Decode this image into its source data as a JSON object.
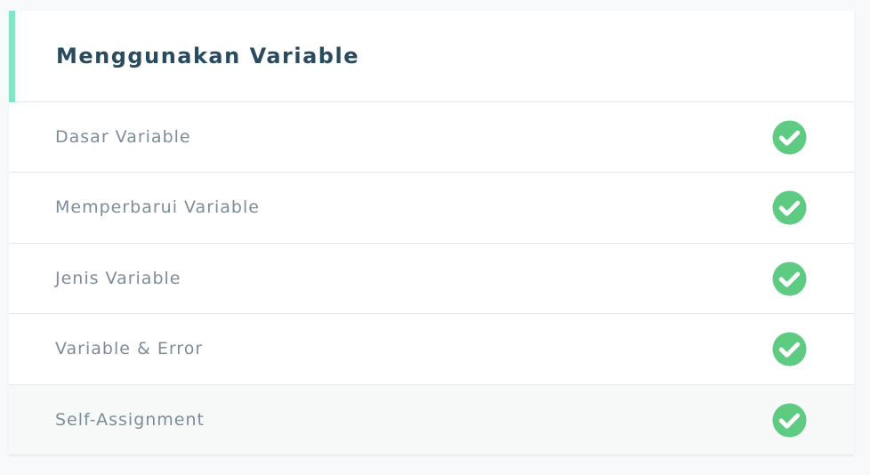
{
  "module": {
    "title": "Menggunakan Variable",
    "accent_color": "#85e3c7",
    "lessons": [
      {
        "label": "Dasar Variable",
        "status": "completed",
        "icon": "check-circle-icon"
      },
      {
        "label": "Memperbarui Variable",
        "status": "completed",
        "icon": "check-circle-icon"
      },
      {
        "label": "Jenis Variable",
        "status": "completed",
        "icon": "check-circle-icon"
      },
      {
        "label": "Variable & Error",
        "status": "completed",
        "icon": "check-circle-icon"
      },
      {
        "label": "Self-Assignment",
        "status": "completed",
        "icon": "check-circle-icon"
      }
    ]
  },
  "colors": {
    "completed": "#5ecb82"
  }
}
